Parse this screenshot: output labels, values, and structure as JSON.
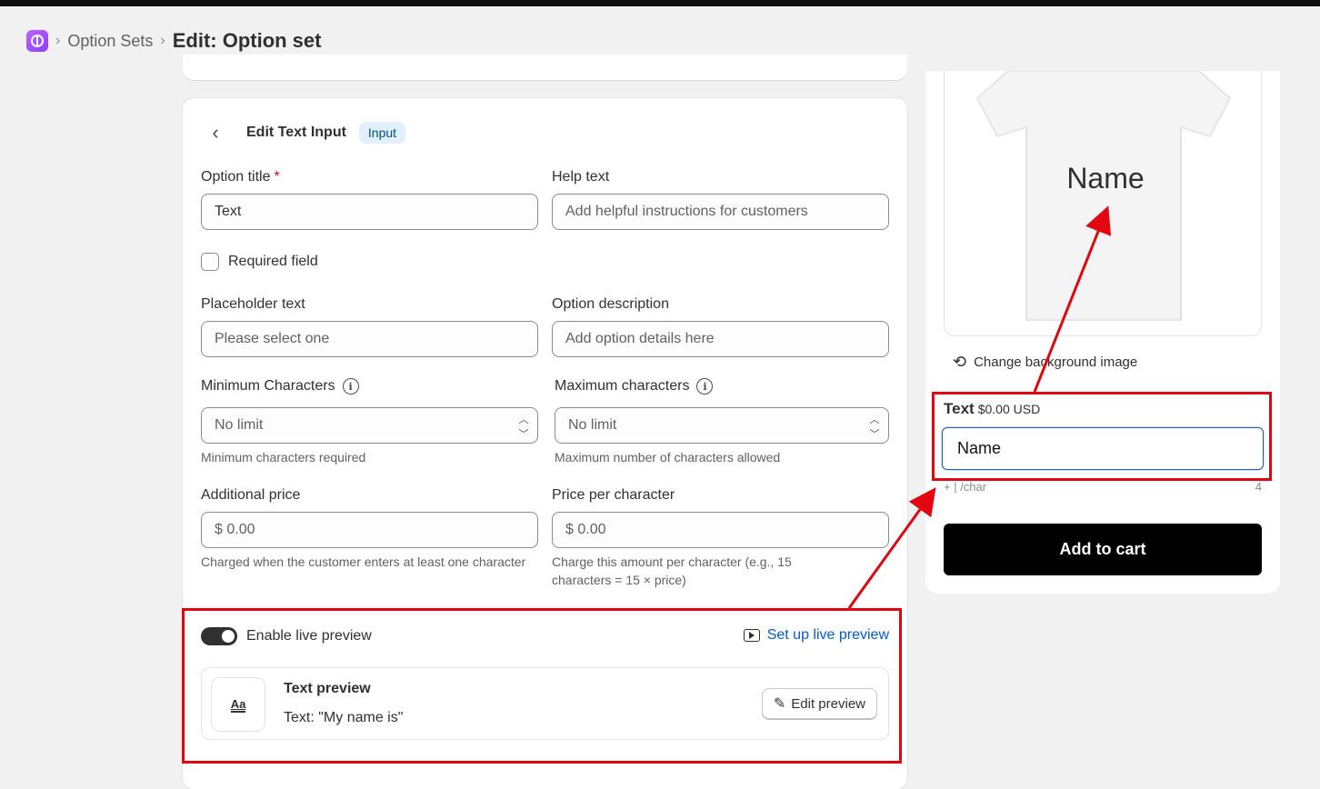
{
  "breadcrumb": {
    "parent": "Option Sets",
    "current": "Edit: Option set",
    "separator": "›"
  },
  "editor": {
    "title": "Edit Text Input",
    "badge": "Input",
    "option_title": {
      "label": "Option title",
      "required_mark": "*",
      "value": "Text"
    },
    "help_text": {
      "label": "Help text",
      "placeholder": "Add helpful instructions for customers"
    },
    "required_field": {
      "label": "Required field",
      "checked": false
    },
    "placeholder_text": {
      "label": "Placeholder text",
      "value": "Please select one"
    },
    "option_description": {
      "label": "Option description",
      "placeholder": "Add option details here"
    },
    "min_chars": {
      "label": "Minimum Characters",
      "value": "No limit",
      "help": "Minimum characters required"
    },
    "max_chars": {
      "label": "Maximum characters",
      "value": "No limit",
      "help": "Maximum number of characters allowed"
    },
    "additional_price": {
      "label": "Additional price",
      "value": "$ 0.00",
      "help": "Charged when the customer enters at least one character"
    },
    "price_per_char": {
      "label": "Price per character",
      "value": "$ 0.00",
      "help": "Charge this amount per character (e.g., 15 characters = 15 × price)"
    },
    "live_preview": {
      "toggle_label": "Enable live preview",
      "enabled": true,
      "setup_link": "Set up live preview",
      "preview_title": "Text preview",
      "preview_subtitle": "Text: \"My name is\"",
      "icon_glyph": "Aa",
      "edit_button": "Edit preview"
    }
  },
  "preview_panel": {
    "shirt_text": "Name",
    "change_background": "Change background image",
    "option_label": "Text",
    "option_price": "$0.00 USD",
    "input_value": "Name",
    "char_hint": "+ | /char",
    "char_count": "4",
    "add_to_cart": "Add to cart"
  },
  "colors": {
    "accent_link": "#005bd3",
    "annotation": "#e3050f",
    "badge_bg": "#e0f0ff",
    "cart_button": "#000000"
  }
}
